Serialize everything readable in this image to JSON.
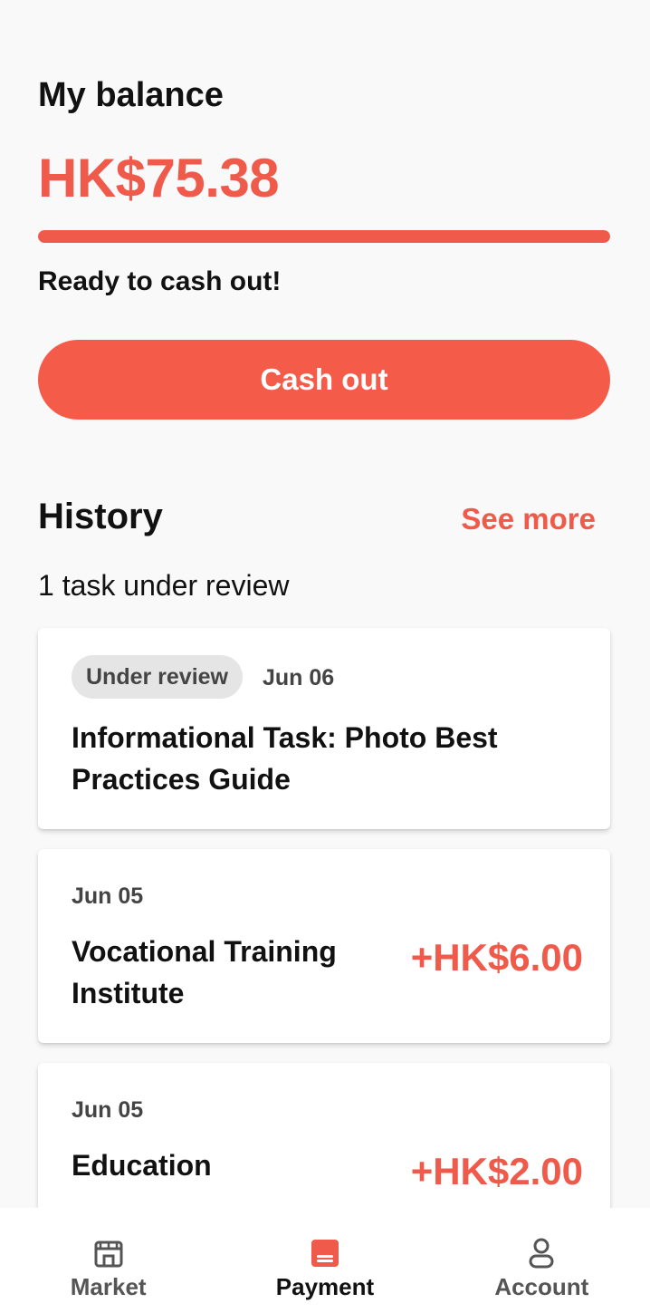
{
  "balance": {
    "title": "My balance",
    "amount": "HK$75.38",
    "progress_percent": 100,
    "status_text": "Ready to cash out!",
    "cashout_label": "Cash out"
  },
  "history": {
    "title": "History",
    "see_more_label": "See more",
    "review_count_text": "1 task under review",
    "items": [
      {
        "badge": "Under review",
        "date": "Jun 06",
        "title": "Informational Task: Photo Best Practices Guide",
        "amount": ""
      },
      {
        "badge": "",
        "date": "Jun 05",
        "title": "Vocational Training Institute",
        "amount": "+HK$6.00"
      },
      {
        "badge": "",
        "date": "Jun 05",
        "title": "Education",
        "amount": "+HK$2.00"
      }
    ]
  },
  "nav": {
    "items": [
      {
        "label": "Market",
        "icon": "store-icon",
        "active": false
      },
      {
        "label": "Payment",
        "icon": "wallet-icon",
        "active": true
      },
      {
        "label": "Account",
        "icon": "person-icon",
        "active": false
      }
    ]
  },
  "colors": {
    "accent": "#f05a4b",
    "button": "#f55b49",
    "badge_bg": "#e5e5e5"
  }
}
